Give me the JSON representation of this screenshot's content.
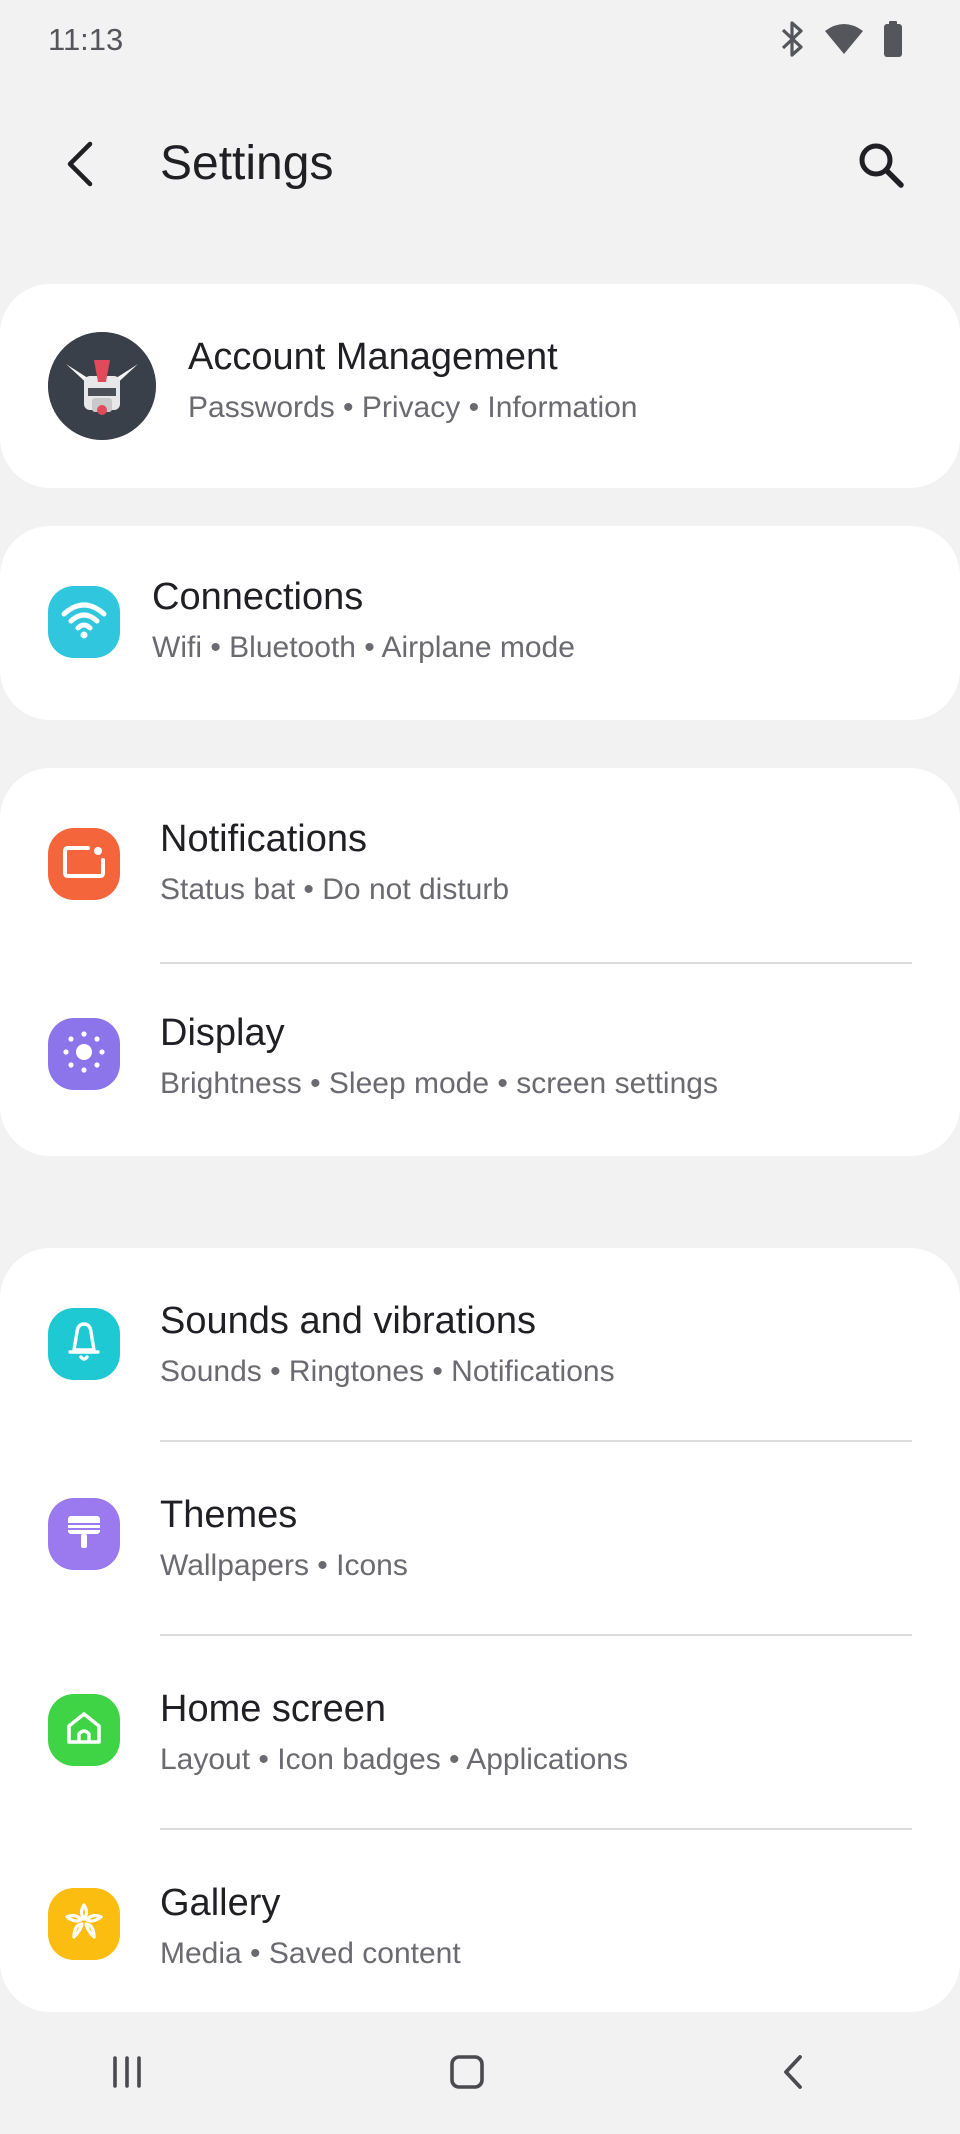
{
  "status_bar": {
    "time": "11:13",
    "icons": [
      "bluetooth-icon",
      "wifi-icon",
      "battery-icon"
    ]
  },
  "app_bar": {
    "title": "Settings",
    "back_icon": "chevron-left-icon",
    "search_icon": "search-icon"
  },
  "account": {
    "title": "Account Management",
    "subtitle": "Passwords • Privacy • Information"
  },
  "connections": {
    "title": "Connections",
    "subtitle": "Wifi • Bluetooth • Airplane mode",
    "icon": "wifi-icon",
    "color": "#2fc6de"
  },
  "group1": [
    {
      "title": "Notifications",
      "subtitle": "Status bat • Do not disturb",
      "icon": "notification-icon",
      "color": "#f4653c"
    },
    {
      "title": "Display",
      "subtitle": "Brightness • Sleep mode • screen settings",
      "icon": "brightness-icon",
      "color": "#8c74ea"
    }
  ],
  "group2": [
    {
      "title": "Sounds and vibrations",
      "subtitle": "Sounds • Ringtones • Notifications",
      "icon": "bell-icon",
      "color": "#1fc9d4"
    },
    {
      "title": "Themes",
      "subtitle": "Wallpapers • Icons",
      "icon": "paint-brush-icon",
      "color": "#9a7aee"
    },
    {
      "title": "Home screen",
      "subtitle": "Layout • Icon badges • Applications",
      "icon": "home-icon",
      "color": "#3ed446"
    },
    {
      "title": "Gallery",
      "subtitle": "Media • Saved content",
      "icon": "flower-icon",
      "color": "#fbbd10"
    }
  ],
  "nav_bar": {
    "recents_icon": "recents-icon",
    "home_icon": "home-button-icon",
    "back_icon": "back-icon"
  }
}
